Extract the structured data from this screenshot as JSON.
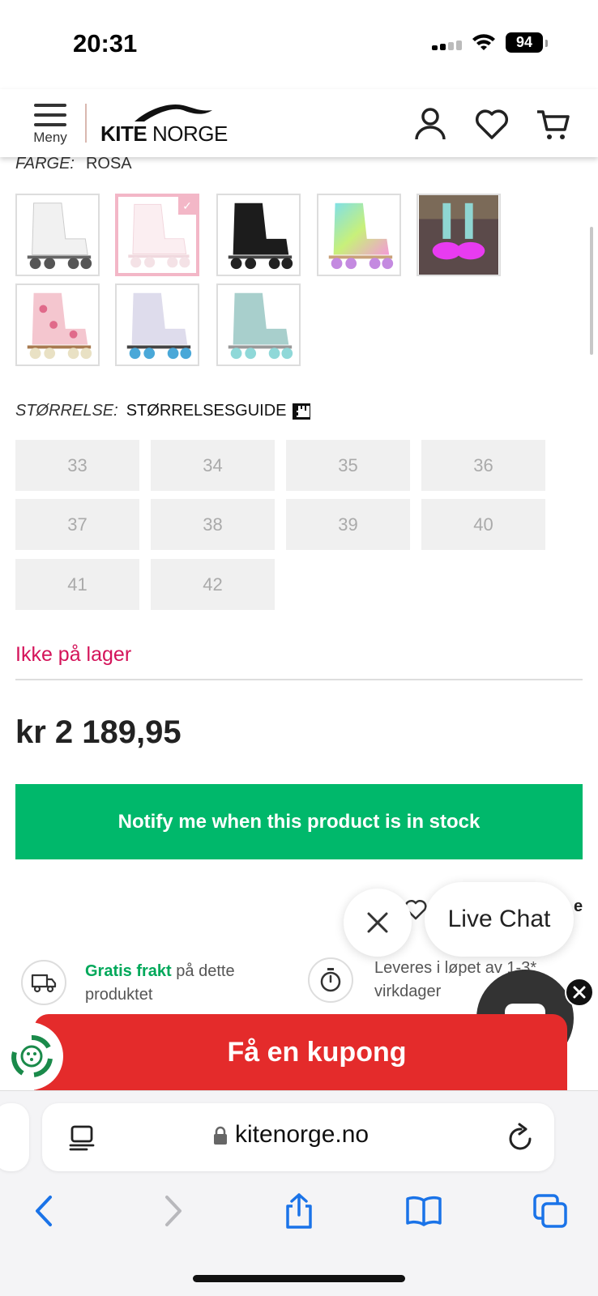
{
  "status_bar": {
    "time": "20:31",
    "battery": "94"
  },
  "header": {
    "menu_label": "Meny",
    "logo_bold": "KITE",
    "logo_light": " NORGE",
    "icons": [
      "account-icon",
      "heart-icon",
      "cart-icon"
    ]
  },
  "product": {
    "color_label": "FARGE:",
    "color_value": "ROSA",
    "swatches": [
      "white",
      "rosa",
      "black",
      "rainbow",
      "led-photo",
      "floral",
      "lavender",
      "mint"
    ],
    "size_label": "STØRRELSE:",
    "size_guide": "STØRRELSESGUIDE",
    "sizes": [
      "33",
      "34",
      "35",
      "36",
      "37",
      "38",
      "39",
      "40",
      "41",
      "42"
    ],
    "stock_status": "Ikke på lager",
    "price": "kr 2 189,95",
    "notify_button": "Notify me when this product is in stock"
  },
  "chat": {
    "live_chat_label": "Live Chat",
    "peek_text": "e"
  },
  "shipping": {
    "free_shipping_bold": "Gratis frakt",
    "free_shipping_rest": " på dette produktet",
    "delivery_text": "Leveres i løpet av 1-3* virkdager"
  },
  "coupon": {
    "label": "Få en kupong"
  },
  "browser": {
    "url": "kitenorge.no"
  },
  "colors": {
    "accent_green": "#00b86b",
    "stock_red": "#d4145a",
    "coupon_red": "#e42b2b",
    "ios_blue": "#1a73e8"
  }
}
